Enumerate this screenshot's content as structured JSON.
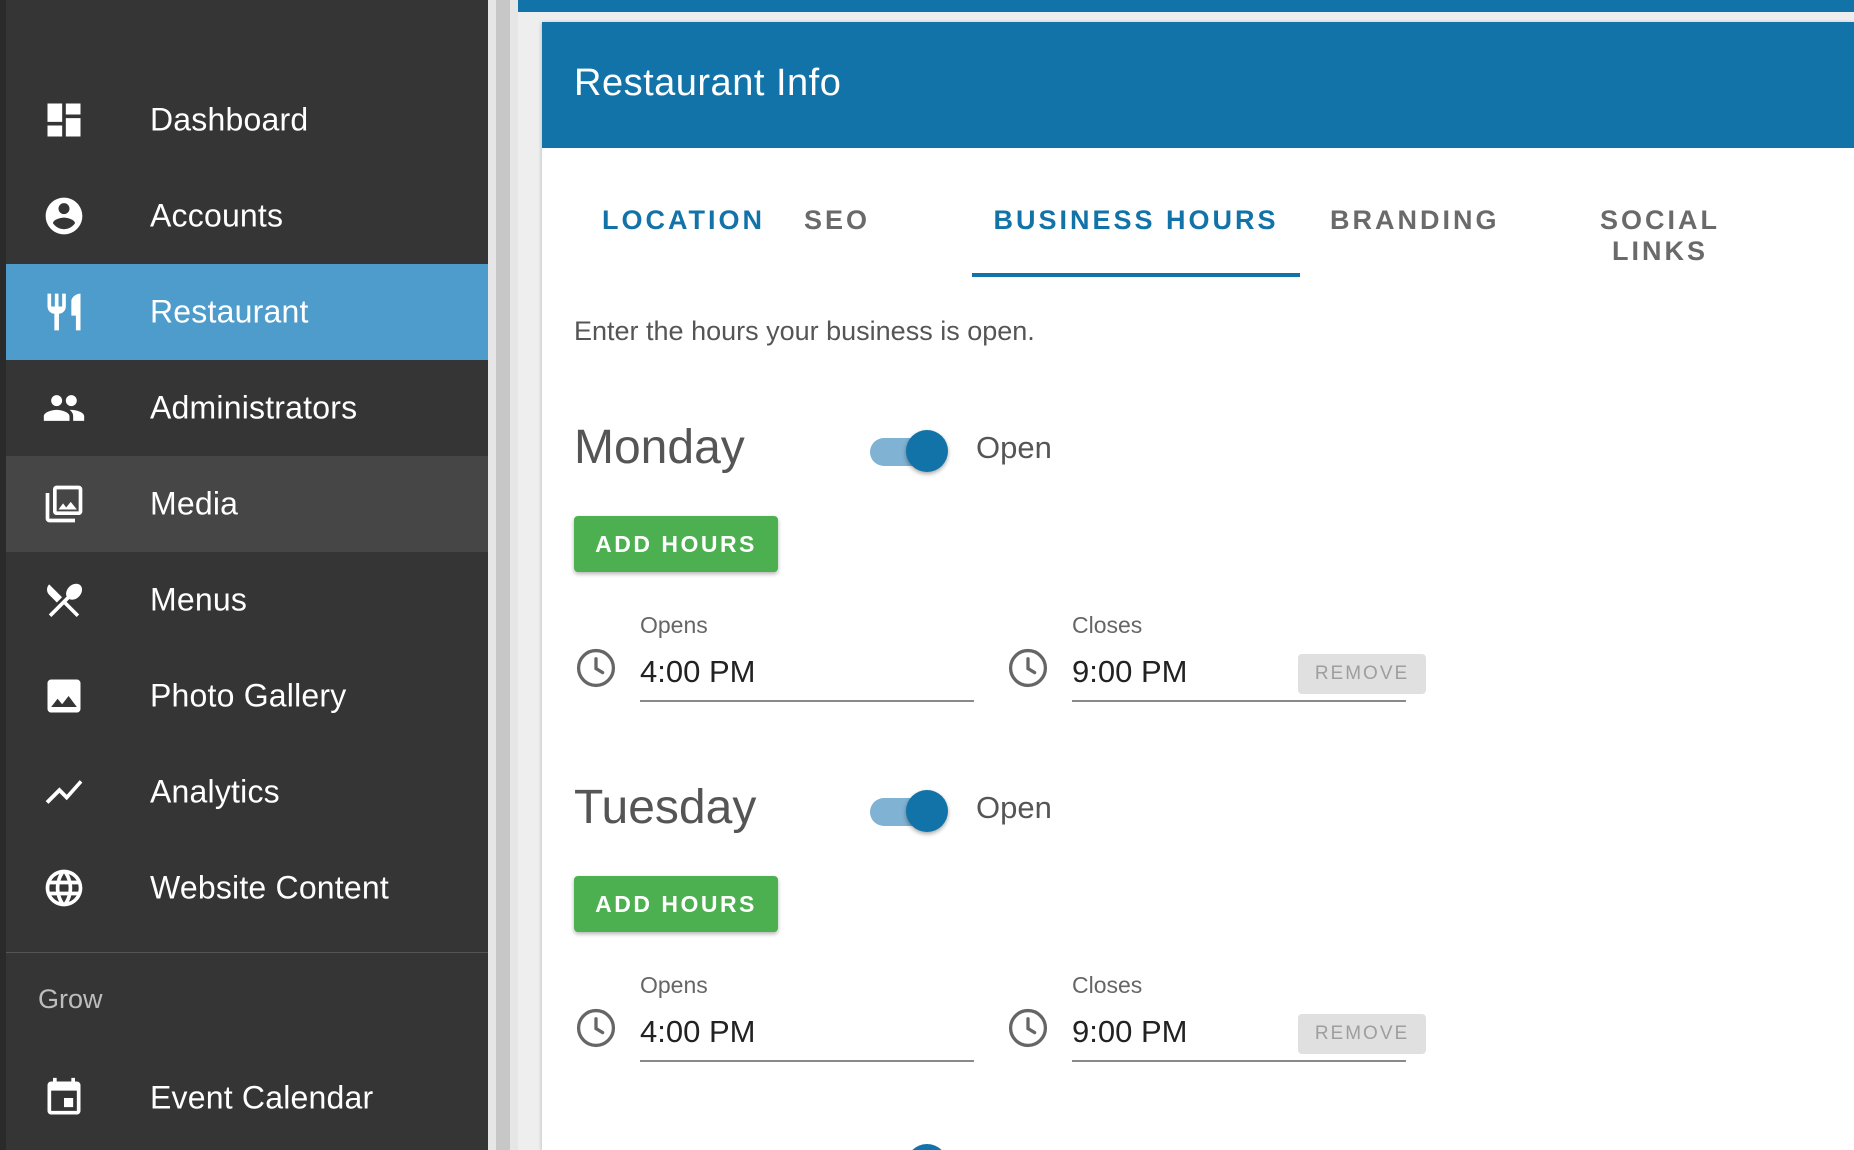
{
  "sidebar": {
    "items": [
      {
        "label": "Dashboard",
        "icon": "dashboard-icon",
        "state": "normal"
      },
      {
        "label": "Accounts",
        "icon": "account-circle-icon",
        "state": "normal"
      },
      {
        "label": "Restaurant",
        "icon": "restaurant-icon",
        "state": "active"
      },
      {
        "label": "Administrators",
        "icon": "people-icon",
        "state": "normal"
      },
      {
        "label": "Media",
        "icon": "photo-library-icon",
        "state": "hover"
      },
      {
        "label": "Menus",
        "icon": "utensils-crossed-icon",
        "state": "normal"
      },
      {
        "label": "Photo Gallery",
        "icon": "image-icon",
        "state": "normal"
      },
      {
        "label": "Analytics",
        "icon": "trending-line-icon",
        "state": "normal"
      },
      {
        "label": "Website Content",
        "icon": "globe-icon",
        "state": "normal"
      }
    ],
    "section_label": "Grow",
    "grow_items": [
      {
        "label": "Event Calendar",
        "icon": "calendar-icon",
        "state": "normal"
      }
    ]
  },
  "card": {
    "title": "Restaurant Info",
    "tabs": [
      {
        "label": "LOCATION",
        "active": false
      },
      {
        "label": "SEO",
        "active": false
      },
      {
        "label": "BUSINESS HOURS",
        "active": true
      },
      {
        "label": "BRANDING",
        "active": false
      },
      {
        "label": "SOCIAL LINKS",
        "active": false
      }
    ],
    "intro": "Enter the hours your business is open."
  },
  "days": [
    {
      "name": "Monday",
      "open": true,
      "status_label": "Open",
      "add_hours_label": "ADD HOURS",
      "opens_label": "Opens",
      "opens_value": "4:00 PM",
      "closes_label": "Closes",
      "closes_value": "9:00 PM",
      "remove_label": "REMOVE"
    },
    {
      "name": "Tuesday",
      "open": true,
      "status_label": "Open",
      "add_hours_label": "ADD HOURS",
      "opens_label": "Opens",
      "opens_value": "4:00 PM",
      "closes_label": "Closes",
      "closes_value": "9:00 PM",
      "remove_label": "REMOVE"
    }
  ],
  "colors": {
    "primary": "#1273a8",
    "sidebar_bg": "#353535",
    "sidebar_active": "#4d9ccb",
    "add_button": "#4caf50",
    "switch_track": "#7fb2d3"
  }
}
